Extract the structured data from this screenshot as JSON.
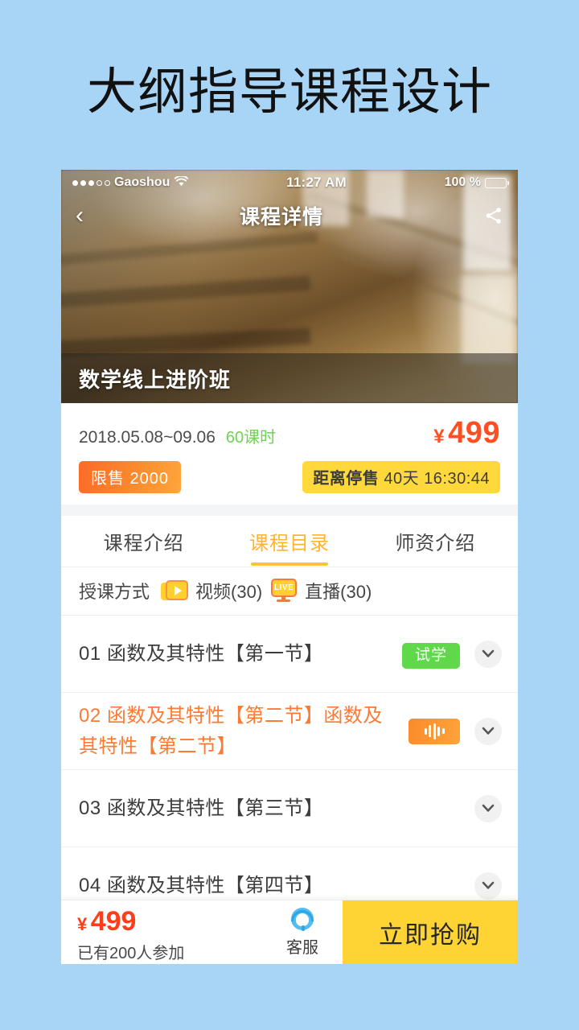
{
  "headline": "大纲指导课程设计",
  "colors": {
    "page_bg": "#a8d4f5",
    "accent_orange": "#fc7a33",
    "accent_yellow": "#fdd434",
    "price_red": "#fe4f22",
    "green": "#5fd94a"
  },
  "status_bar": {
    "carrier": "Gaoshou",
    "wifi_icon": "wifi-icon",
    "time": "11:27 AM",
    "battery_percent": "100 %",
    "battery_icon": "battery-full-icon"
  },
  "nav": {
    "back_icon": "chevron-left-icon",
    "title": "课程详情",
    "share_icon": "share-icon"
  },
  "hero": {
    "caption": "数学线上进阶班"
  },
  "price_block": {
    "date_range": "2018.05.08~09.06",
    "hours": "60课时",
    "currency": "¥",
    "price": "499",
    "limit_badge": "限售  2000",
    "countdown_label": "距离停售",
    "countdown_value": "40天 16:30:44"
  },
  "tabs": [
    {
      "label": "课程介绍",
      "active": false
    },
    {
      "label": "课程目录",
      "active": true
    },
    {
      "label": "师资介绍",
      "active": false
    }
  ],
  "method": {
    "label": "授课方式",
    "video_icon": "video-play-icon",
    "video_text": "视频(30)",
    "live_icon": "live-monitor-icon",
    "live_badge_text": "LIVE",
    "live_text": "直播(30)"
  },
  "lessons": [
    {
      "title": "01 函数及其特性【第一节】",
      "tag": "试学",
      "tag_type": "trial",
      "active": false,
      "chevron_icon": "chevron-down-icon"
    },
    {
      "title": "02 函数及其特性【第二节】函数及其特性【第二节】",
      "tag": "",
      "tag_type": "audio",
      "active": true,
      "chevron_icon": "chevron-down-icon"
    },
    {
      "title": "03 函数及其特性【第三节】",
      "tag": "",
      "tag_type": "none",
      "active": false,
      "chevron_icon": "chevron-down-icon"
    },
    {
      "title": "04 函数及其特性【第四节】",
      "tag": "",
      "tag_type": "none",
      "active": false,
      "chevron_icon": "chevron-down-icon"
    }
  ],
  "bottom_bar": {
    "currency": "¥",
    "price": "499",
    "participants": "已有200人参加",
    "service_icon": "customer-service-icon",
    "service_label": "客服",
    "buy_label": "立即抢购"
  }
}
